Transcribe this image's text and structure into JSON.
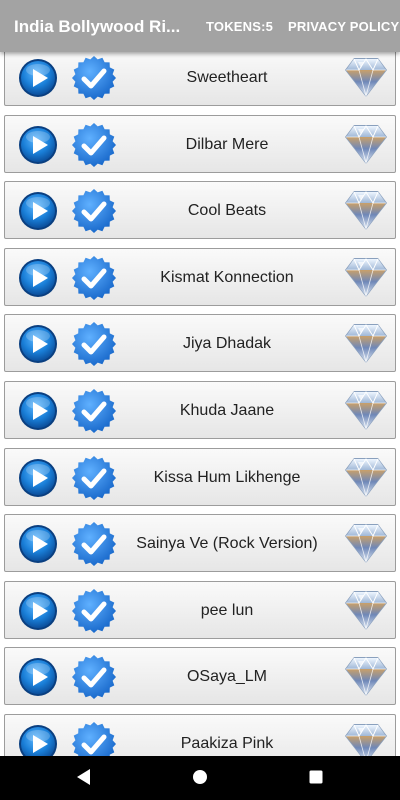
{
  "app_bar": {
    "title": "India Bollywood Ri...",
    "tokens": "TOKENS:5",
    "privacy": "PRIVACY POLICY"
  },
  "songs": [
    {
      "title": "Sweetheart"
    },
    {
      "title": "Dilbar Mere"
    },
    {
      "title": "Cool Beats"
    },
    {
      "title": "Kismat Konnection"
    },
    {
      "title": "Jiya Dhadak"
    },
    {
      "title": "Khuda Jaane"
    },
    {
      "title": "Kissa Hum Likhenge"
    },
    {
      "title": "Sainya Ve (Rock Version)"
    },
    {
      "title": "pee lun"
    },
    {
      "title": "OSaya_LM"
    },
    {
      "title": "Paakiza Pink"
    }
  ],
  "icons": {
    "play": "play-icon",
    "check": "check-badge-icon",
    "diamond": "diamond-icon",
    "nav_back": "back-triangle-icon",
    "nav_home": "home-circle-icon",
    "nav_recents": "recents-square-icon"
  },
  "colors": {
    "app_bar": "#a3a3a3",
    "play_blue": "#1a7fd8",
    "check_blue": "#1f7ee0"
  }
}
